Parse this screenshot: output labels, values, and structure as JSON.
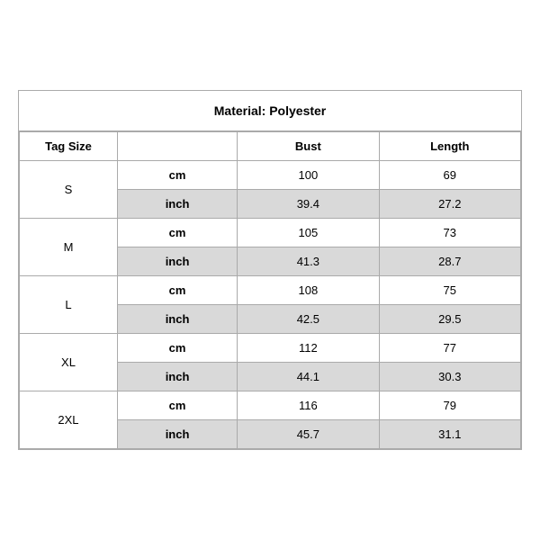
{
  "title": "Material: Polyester",
  "headers": {
    "tag_size": "Tag Size",
    "bust": "Bust",
    "length": "Length"
  },
  "sizes": [
    {
      "name": "S",
      "cm": {
        "bust": "100",
        "length": "69"
      },
      "inch": {
        "bust": "39.4",
        "length": "27.2"
      }
    },
    {
      "name": "M",
      "cm": {
        "bust": "105",
        "length": "73"
      },
      "inch": {
        "bust": "41.3",
        "length": "28.7"
      }
    },
    {
      "name": "L",
      "cm": {
        "bust": "108",
        "length": "75"
      },
      "inch": {
        "bust": "42.5",
        "length": "29.5"
      }
    },
    {
      "name": "XL",
      "cm": {
        "bust": "112",
        "length": "77"
      },
      "inch": {
        "bust": "44.1",
        "length": "30.3"
      }
    },
    {
      "name": "2XL",
      "cm": {
        "bust": "116",
        "length": "79"
      },
      "inch": {
        "bust": "45.7",
        "length": "31.1"
      }
    }
  ],
  "units": {
    "cm": "cm",
    "inch": "inch"
  }
}
